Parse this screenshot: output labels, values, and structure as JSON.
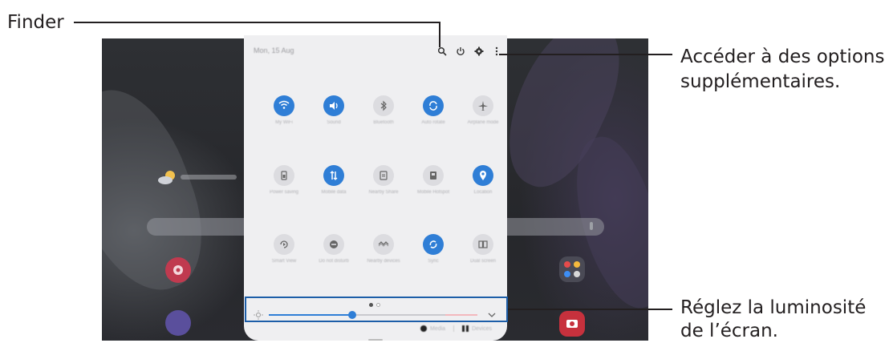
{
  "callouts": {
    "finder": "Finder",
    "options_line1": "Accéder à des options",
    "options_line2": "supplémentaires.",
    "brightness_line1": "Réglez la luminosité",
    "brightness_line2": "de l’écran."
  },
  "panel": {
    "status_text": "Mon, 15 Aug",
    "top_icons": [
      "search-icon",
      "power-icon",
      "settings-icon",
      "more-options-icon"
    ],
    "tiles": [
      {
        "name": "wifi",
        "label": "My WiFi",
        "state": "on",
        "icon": "wifi-icon"
      },
      {
        "name": "sound",
        "label": "Sound",
        "state": "on",
        "icon": "volume-icon"
      },
      {
        "name": "bluetooth",
        "label": "Bluetooth",
        "state": "off",
        "icon": "bluetooth-icon"
      },
      {
        "name": "auto-rotate",
        "label": "Auto rotate",
        "state": "on",
        "icon": "rotate-icon"
      },
      {
        "name": "airplane-mode",
        "label": "Airplane mode",
        "state": "off",
        "icon": "airplane-icon"
      },
      {
        "name": "power-saving",
        "label": "Power saving",
        "state": "off",
        "icon": "battery-icon"
      },
      {
        "name": "mobile-data",
        "label": "Mobile data",
        "state": "on",
        "icon": "data-transfer-icon"
      },
      {
        "name": "nearby-share",
        "label": "Nearby Share",
        "state": "off",
        "icon": "share-icon"
      },
      {
        "name": "mobile-hotspot",
        "label": "Mobile Hotspot",
        "state": "off",
        "icon": "hotspot-icon"
      },
      {
        "name": "location",
        "label": "Location",
        "state": "on",
        "icon": "location-icon"
      },
      {
        "name": "smart-view",
        "label": "Smart View",
        "state": "off",
        "icon": "smart-view-icon"
      },
      {
        "name": "do-not-disturb",
        "label": "Do not disturb",
        "state": "off",
        "icon": "do-not-disturb-icon"
      },
      {
        "name": "nearby-devices",
        "label": "Nearby devices",
        "state": "off",
        "icon": "nearby-icon"
      },
      {
        "name": "sync",
        "label": "Sync",
        "state": "on",
        "icon": "sync-icon"
      },
      {
        "name": "dual-screen",
        "label": "Dual screen",
        "state": "off",
        "icon": "book-icon"
      }
    ],
    "page_indicator": {
      "current": 1,
      "total": 2
    },
    "brightness": {
      "level_fraction": 0.4
    },
    "bottom_bar": {
      "left_label": "Media",
      "right_label": "Devices"
    }
  },
  "colors": {
    "accent": "#2f7ed6",
    "callout_box": "#1d5ea8",
    "text": "#231f20"
  }
}
